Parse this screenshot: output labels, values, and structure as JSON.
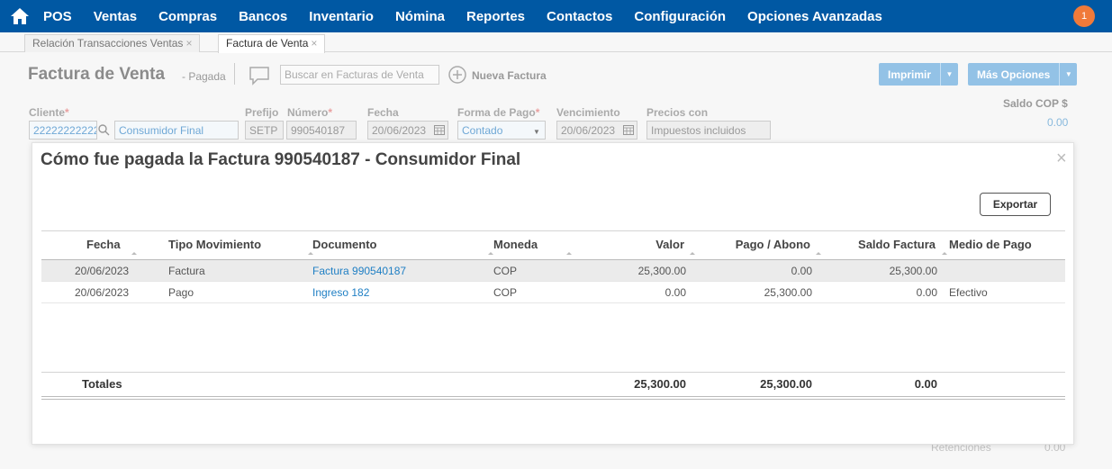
{
  "nav": {
    "items": [
      "POS",
      "Ventas",
      "Compras",
      "Bancos",
      "Inventario",
      "Nómina",
      "Reportes",
      "Contactos",
      "Configuración",
      "Opciones Avanzadas"
    ],
    "notification_count": "1"
  },
  "tabs": [
    {
      "label": "Relación Transacciones Ventas",
      "close": "×"
    },
    {
      "label": "Factura de Venta",
      "close": "×"
    }
  ],
  "page": {
    "title": "Factura de Venta",
    "status": "- Pagada",
    "search_placeholder": "Buscar en Facturas de Venta",
    "new_button": "Nueva Factura",
    "print_button": "Imprimir",
    "more_button": "Más Opciones",
    "saldo_label": "Saldo COP $",
    "saldo_value": "0.00"
  },
  "fields": {
    "cliente_label": "Cliente",
    "cliente_id": "222222222222",
    "cliente_name": "Consumidor Final",
    "prefijo_label": "Prefijo",
    "prefijo": "SETP",
    "numero_label": "Número",
    "numero": "990540187",
    "fecha_label": "Fecha",
    "fecha": "20/06/2023",
    "forma_label": "Forma de Pago",
    "forma": "Contado",
    "vencimiento_label": "Vencimiento",
    "vencimiento": "20/06/2023",
    "precios_label": "Precios con",
    "precios": "Impuestos incluidos",
    "required_mark": "*"
  },
  "background_residue": {
    "retenciones_label": "Retenciones",
    "retenciones_value": "0.00"
  },
  "modal": {
    "title": "Cómo fue pagada la Factura 990540187 - Consumidor Final",
    "close": "×",
    "export_button": "Exportar",
    "columns": [
      "Fecha",
      "Tipo Movimiento",
      "Documento",
      "Moneda",
      "Valor",
      "Pago / Abono",
      "Saldo Factura",
      "Medio de Pago"
    ],
    "rows": [
      {
        "fecha": "20/06/2023",
        "tipo": "Factura",
        "documento": "Factura 990540187",
        "moneda": "COP",
        "valor": "25,300.00",
        "pago": "0.00",
        "saldo": "25,300.00",
        "medio": ""
      },
      {
        "fecha": "20/06/2023",
        "tipo": "Pago",
        "documento": "Ingreso 182",
        "moneda": "COP",
        "valor": "0.00",
        "pago": "25,300.00",
        "saldo": "0.00",
        "medio": "Efectivo"
      }
    ],
    "totals": {
      "label": "Totales",
      "valor": "25,300.00",
      "pago": "25,300.00",
      "saldo": "0.00"
    }
  }
}
